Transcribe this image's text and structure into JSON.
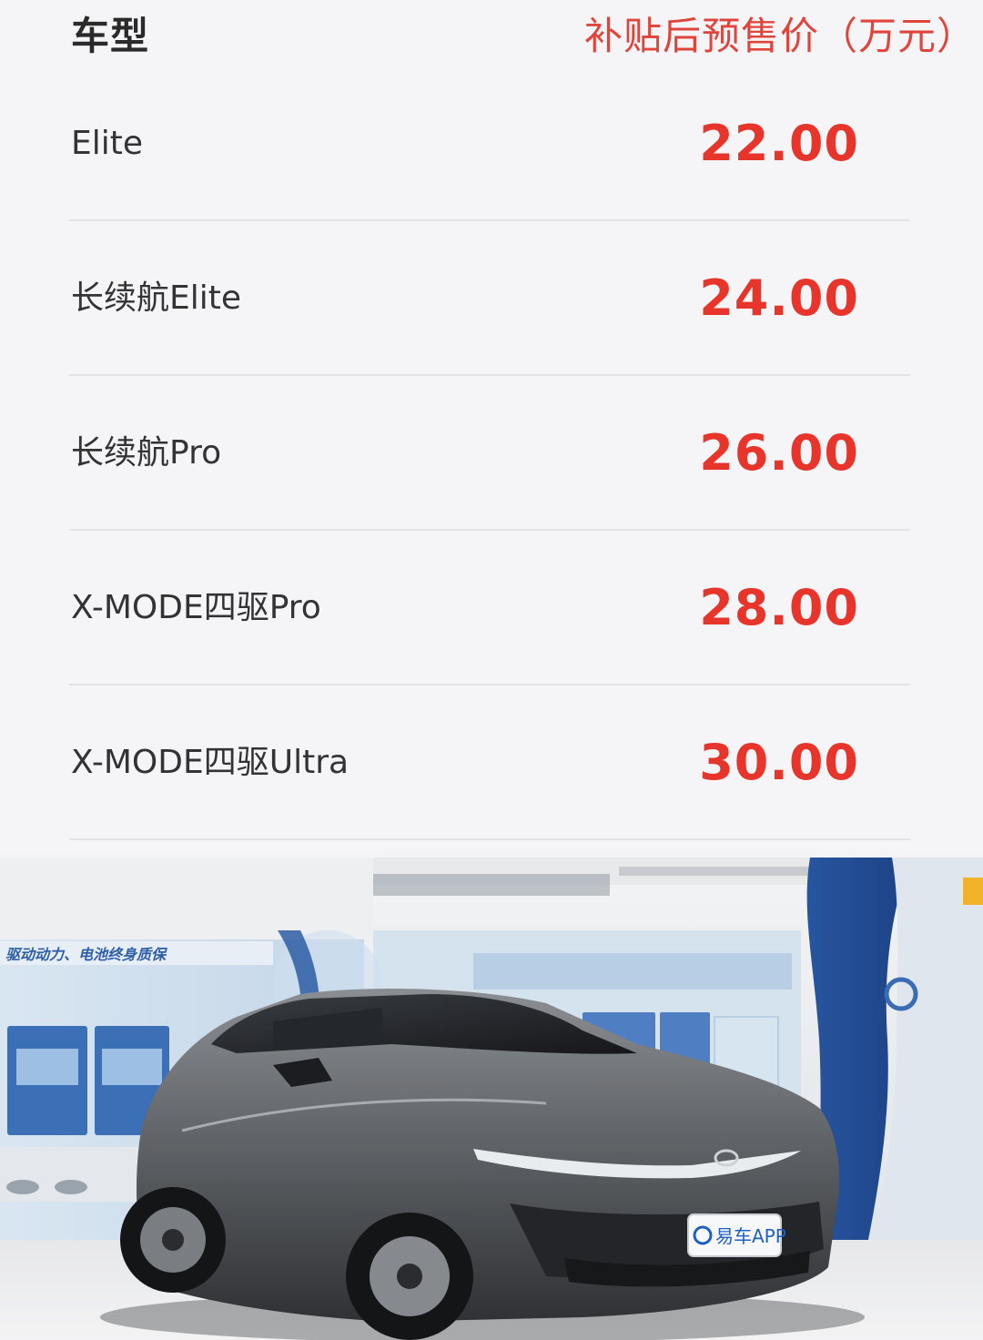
{
  "header": {
    "model_label": "车型",
    "price_label": "补贴后预售价（万元）"
  },
  "rows": [
    {
      "name": "Elite",
      "price": "22.00"
    },
    {
      "name": "长续航Elite",
      "price": "24.00"
    },
    {
      "name": "长续航Pro",
      "price": "26.00"
    },
    {
      "name": "X-MODE四驱Pro",
      "price": "28.00"
    },
    {
      "name": "X-MODE四驱Ultra",
      "price": "30.00"
    }
  ],
  "photo": {
    "wall_slogan": "驱动动力、电池终身质保",
    "watermark": "易车APP"
  },
  "colors": {
    "price_red": "#e8352b",
    "header_red": "#e0453c",
    "brand_blue": "#2f5fa8"
  }
}
